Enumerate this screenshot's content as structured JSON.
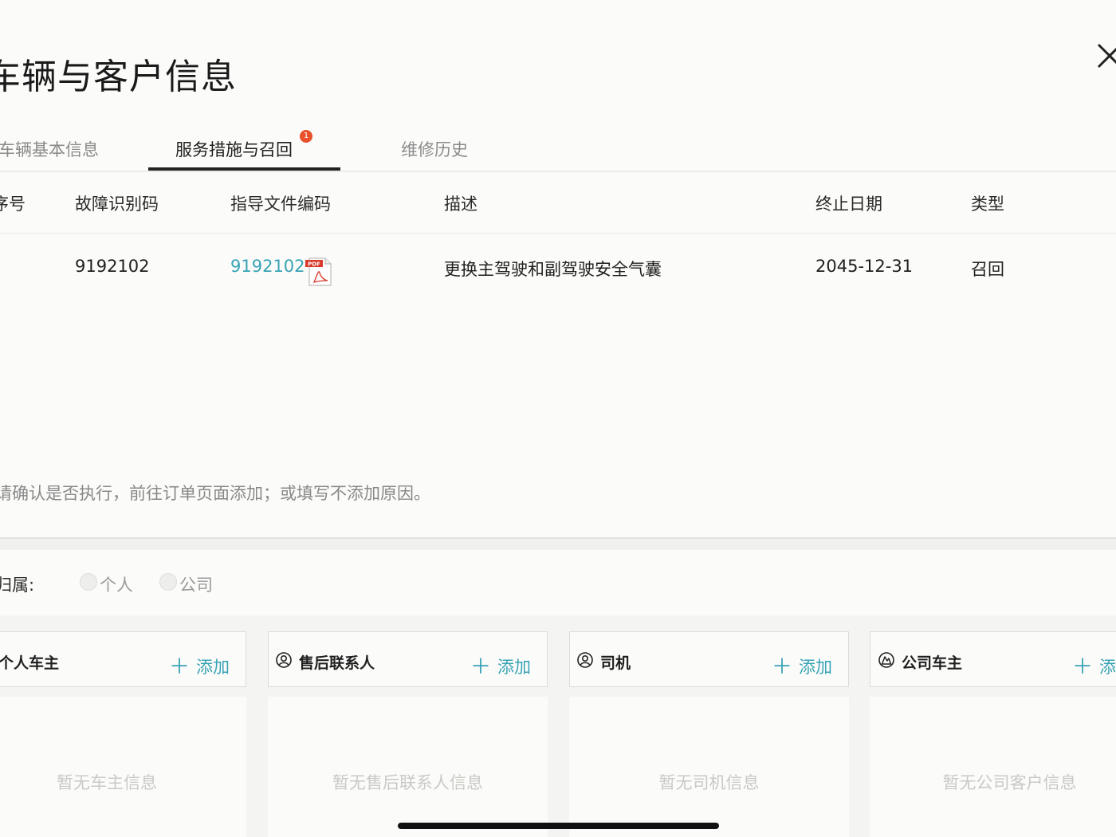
{
  "header": {
    "title": "车辆与客户信息"
  },
  "tabs": [
    {
      "label": "车辆基本信息"
    },
    {
      "label": "服务措施与召回",
      "badge": "1"
    },
    {
      "label": "维修历史"
    }
  ],
  "table": {
    "columns": [
      "序号",
      "故障识别码",
      "指导文件编码",
      "描述",
      "终止日期",
      "类型"
    ],
    "rows": [
      {
        "index": "",
        "fault_code": "9192102",
        "doc_code": "9192102",
        "description": "更换主驾驶和副驾驶安全气囊",
        "end_date": "2045-12-31",
        "type": "召回"
      }
    ]
  },
  "notice": "请确认是否执行，前往订单页面添加；或填写不添加原因。",
  "ownership": {
    "label": "归属:",
    "options": [
      "个人",
      "公司"
    ]
  },
  "cards": [
    {
      "title": "个人车主",
      "add_label": "添加",
      "empty_text": "暂无车主信息",
      "icon": "person-icon"
    },
    {
      "title": "售后联系人",
      "add_label": "添加",
      "empty_text": "暂无售后联系人信息",
      "icon": "person-icon"
    },
    {
      "title": "司机",
      "add_label": "添加",
      "empty_text": "暂无司机信息",
      "icon": "person-icon"
    },
    {
      "title": "公司车主",
      "add_label": "添",
      "empty_text": "暂无公司客户信息",
      "icon": "company-icon"
    }
  ],
  "colors": {
    "accent": "#37a3b5",
    "badge": "#e8512c",
    "background": "#fbfbf9"
  }
}
